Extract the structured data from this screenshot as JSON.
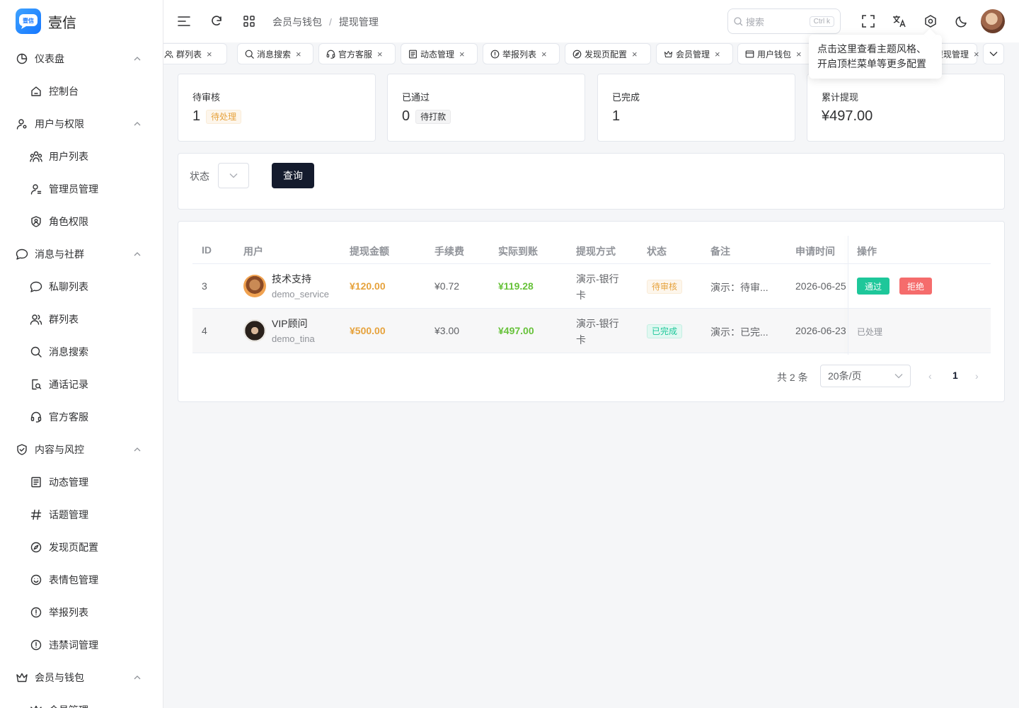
{
  "app": {
    "name": "壹信",
    "logo_text": "壹信"
  },
  "sidebar": {
    "groups": [
      {
        "label": "仪表盘",
        "icon": "pie-chart-icon",
        "items": [
          {
            "label": "控制台",
            "icon": "home-icon"
          }
        ]
      },
      {
        "label": "用户与权限",
        "icon": "user-settings-icon",
        "items": [
          {
            "label": "用户列表",
            "icon": "users-icon"
          },
          {
            "label": "管理员管理",
            "icon": "user-admin-icon"
          },
          {
            "label": "角色权限",
            "icon": "shield-user-icon"
          }
        ]
      },
      {
        "label": "消息与社群",
        "icon": "message-icon",
        "items": [
          {
            "label": "私聊列表",
            "icon": "chat-bubble-icon"
          },
          {
            "label": "群列表",
            "icon": "group-icon"
          },
          {
            "label": "消息搜索",
            "icon": "search-icon"
          },
          {
            "label": "通话记录",
            "icon": "call-record-icon"
          },
          {
            "label": "官方客服",
            "icon": "headset-icon"
          }
        ]
      },
      {
        "label": "内容与风控",
        "icon": "shield-check-icon",
        "items": [
          {
            "label": "动态管理",
            "icon": "document-icon"
          },
          {
            "label": "话题管理",
            "icon": "hash-icon"
          },
          {
            "label": "发现页配置",
            "icon": "compass-icon"
          },
          {
            "label": "表情包管理",
            "icon": "smile-icon"
          },
          {
            "label": "举报列表",
            "icon": "alert-circle-icon"
          },
          {
            "label": "违禁词管理",
            "icon": "alert-circle-icon"
          }
        ]
      },
      {
        "label": "会员与钱包",
        "icon": "crown-icon",
        "items": [
          {
            "label": "会员管理",
            "icon": "crown-icon"
          }
        ]
      }
    ]
  },
  "header": {
    "breadcrumb": [
      "会员与钱包",
      "提现管理"
    ],
    "breadcrumb_sep": "/",
    "search_placeholder": "搜索",
    "search_shortcut": "Ctrl k"
  },
  "tabs": [
    {
      "label": "群列表",
      "icon": "group-icon"
    },
    {
      "label": "消息搜索",
      "icon": "search-icon"
    },
    {
      "label": "官方客服",
      "icon": "headset-icon"
    },
    {
      "label": "动态管理",
      "icon": "document-icon"
    },
    {
      "label": "举报列表",
      "icon": "alert-circle-icon"
    },
    {
      "label": "发现页配置",
      "icon": "compass-icon"
    },
    {
      "label": "会员管理",
      "icon": "crown-icon"
    },
    {
      "label": "用户钱包",
      "icon": "wallet-icon"
    },
    {
      "label": "提现管理",
      "icon": ""
    }
  ],
  "tooltip": {
    "line1": "点击这里查看主题风格、",
    "line2": "开启顶栏菜单等更多配置"
  },
  "stats": [
    {
      "label": "待审核",
      "value": "1",
      "tag": "待处理",
      "tag_type": "warn"
    },
    {
      "label": "已通过",
      "value": "0",
      "tag": "待打款",
      "tag_type": "info"
    },
    {
      "label": "已完成",
      "value": "1",
      "tag": "",
      "tag_type": ""
    },
    {
      "label": "累计提现",
      "value": "¥497.00",
      "tag": "",
      "tag_type": ""
    }
  ],
  "filter": {
    "status_label": "状态",
    "query_label": "查询"
  },
  "table": {
    "columns": [
      "ID",
      "用户",
      "提现金额",
      "手续费",
      "实际到账",
      "提现方式",
      "状态",
      "备注",
      "申请时间",
      "操作"
    ],
    "rows": [
      {
        "id": "3",
        "name": "技术支持",
        "username": "demo_service",
        "amount": "¥120.00",
        "fee": "¥0.72",
        "net": "¥119.28",
        "method_line1": "演示-银行",
        "method_line2": "卡",
        "status": "待审核",
        "status_type": "warn",
        "remark": "演示：待审...",
        "time": "2026-06-25",
        "approve": "通过",
        "reject": "拒绝",
        "done_text": ""
      },
      {
        "id": "4",
        "name": "VIP顾问",
        "username": "demo_tina",
        "amount": "¥500.00",
        "fee": "¥3.00",
        "net": "¥497.00",
        "method_line1": "演示-银行",
        "method_line2": "卡",
        "status": "已完成",
        "status_type": "success",
        "remark": "演示：已完...",
        "time": "2026-06-23",
        "approve": "",
        "reject": "",
        "done_text": "已处理"
      }
    ]
  },
  "pagination": {
    "total_text": "共 2 条",
    "page_size": "20条/页",
    "current_page": "1"
  },
  "colors": {
    "primary_dark": "#141b2d",
    "success": "#1ec79a",
    "danger": "#f56c6c",
    "warning": "#e6a23c",
    "money_green": "#67c23a"
  }
}
